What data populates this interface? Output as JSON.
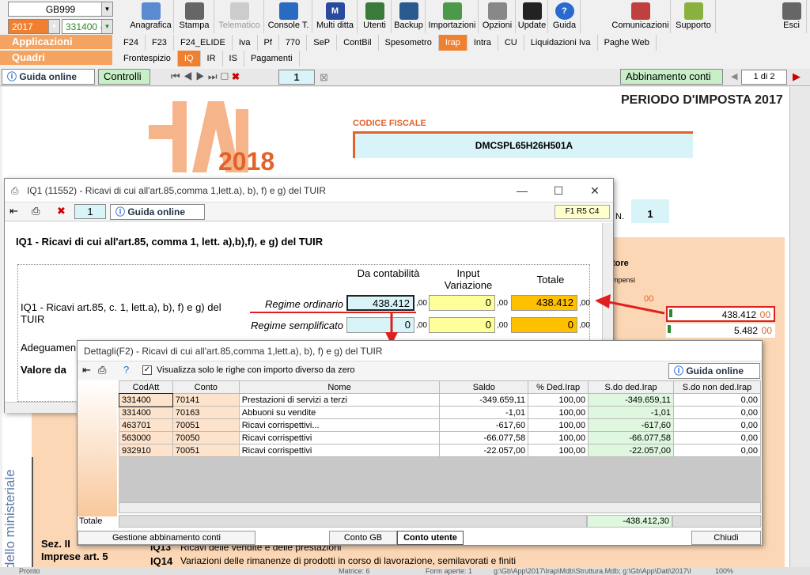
{
  "top": {
    "company": "GB999",
    "year": "2017",
    "activity_code": "331400 - ",
    "band_applicazioni": "Applicazioni",
    "band_quadri": "Quadri",
    "toolbar_buttons": [
      "Anagrafica",
      "Stampa",
      "Telematico",
      "Console T.",
      "Multi ditta",
      "Utenti",
      "Backup",
      "Importazioni",
      "Opzioni",
      "Update",
      "Guida"
    ],
    "right_buttons": [
      "Comunicazioni",
      "Supporto",
      "Esci"
    ],
    "tabs_main": [
      "F24",
      "F23",
      "F24_ELIDE",
      "Iva",
      "Pf",
      "770",
      "SeP",
      "ContBil",
      "Spesometro",
      "Irap",
      "Intra",
      "CU",
      "Liquidazioni Iva",
      "Paghe Web"
    ],
    "tabs_quadri": [
      "Frontespizio",
      "IQ",
      "IR",
      "IS",
      "Pagamenti"
    ],
    "selected_main": "Irap",
    "selected_quadri": "IQ"
  },
  "toolbar2": {
    "guida_online": "Guida online",
    "controlli": "Controlli",
    "page_num": "1",
    "abbinamento": "Abbinamento conti",
    "page_of": "1 di 2"
  },
  "form": {
    "periodo": "PERIODO D'IMPOSTA 2017",
    "codice_fiscale_label": "CODICE FISCALE",
    "codice_fiscale": "DMCSPL65H26H501A",
    "irap_year": "2018",
    "n_label": "N.",
    "n_value": "1",
    "tore": "tore",
    "compensi": "mpensi",
    "val_00": "00",
    "val_main": "438.412",
    "dec_main": "00",
    "val_second": "5.482",
    "dec_second": "00",
    "ministeriale": "dello ministeriale",
    "sez": "Sez. II",
    "imprese": "Imprese art. 5",
    "iq13": "IQ13",
    "iq13_text": "Ricavi delle vendite e delle prestazioni",
    "iq14": "IQ14",
    "iq14_text": "Variazioni delle rimanenze di prodotti in corso di lavorazione, semilavorati e finiti"
  },
  "dialog1": {
    "title": "IQ1 (11552) - Ricavi di cui all'art.85,comma 1,lett.a), b), f) e g) del TUIR",
    "page": "1",
    "guida": "Guida online",
    "frc": "F1 R5 C4",
    "heading": "IQ1 - Ricavi di cui all'art.85, comma 1, lett. a),b),f), e g) del TUIR",
    "col_contabilita": "Da contabilità",
    "col_input": "Input Variazione",
    "col_totale": "Totale",
    "row_label": "IQ1  - Ricavi art.85, c. 1, lett.a), b), f) e g) del TUIR",
    "regime_ordinario": "Regime ordinario",
    "regime_semplificato": "Regime semplificato",
    "adeguamento": "Adeguamen",
    "valore": "Valore da",
    "ord_cont": "438.412",
    "ord_input": "0",
    "ord_tot": "438.412",
    "sem_cont": "0",
    "sem_input": "0",
    "sem_tot": "0",
    "dec": ",00"
  },
  "dialog2": {
    "title": "Dettagli(F2) - Ricavi di cui all'art.85,comma 1,lett.a), b), f) e g) del TUIR",
    "checkbox_label": "Visualizza solo le righe con importo diverso da zero",
    "guida": "Guida online",
    "columns": [
      "CodAtt",
      "Conto",
      "Nome",
      "Saldo",
      "% Ded.Irap",
      "S.do ded.Irap",
      "S.do non ded.Irap"
    ],
    "rows": [
      [
        "331400",
        "70141",
        "Prestazioni di servizi a terzi",
        "-349.659,11",
        "100,00",
        "-349.659,11",
        "0,00"
      ],
      [
        "331400",
        "70163",
        "Abbuoni su vendite",
        "-1,01",
        "100,00",
        "-1,01",
        "0,00"
      ],
      [
        "463701",
        "70051",
        "Ricavi corrispettivi...",
        "-617,60",
        "100,00",
        "-617,60",
        "0,00"
      ],
      [
        "563000",
        "70050",
        "Ricavi corrispettivi",
        "-66.077,58",
        "100,00",
        "-66.077,58",
        "0,00"
      ],
      [
        "932910",
        "70051",
        "Ricavi corrispettivi",
        "-22.057,00",
        "100,00",
        "-22.057,00",
        "0,00"
      ]
    ],
    "totale_label": "Totale",
    "totale_value": "-438.412,30",
    "btn_gestione": "Gestione abbinamento conti",
    "btn_conto_gb": "Conto GB",
    "btn_conto_utente": "Conto utente",
    "btn_chiudi": "Chiudi"
  },
  "status": {
    "pronto": "Pronto",
    "matrice": "Matrice: 6",
    "form_aperte": "Form aperte: 1",
    "path": "g:\\Gb\\App\\2017\\Irap\\Mdb\\Struttura.Mdb; g:\\Gb\\App\\Dati\\2017\\I",
    "zoom": "100%"
  },
  "colors": {
    "accent": "#f08030",
    "band": "#f4a460",
    "yellow": "#ffff99",
    "gold": "#ffc000",
    "cyan": "#d8f4f8",
    "red": "#e02020"
  }
}
